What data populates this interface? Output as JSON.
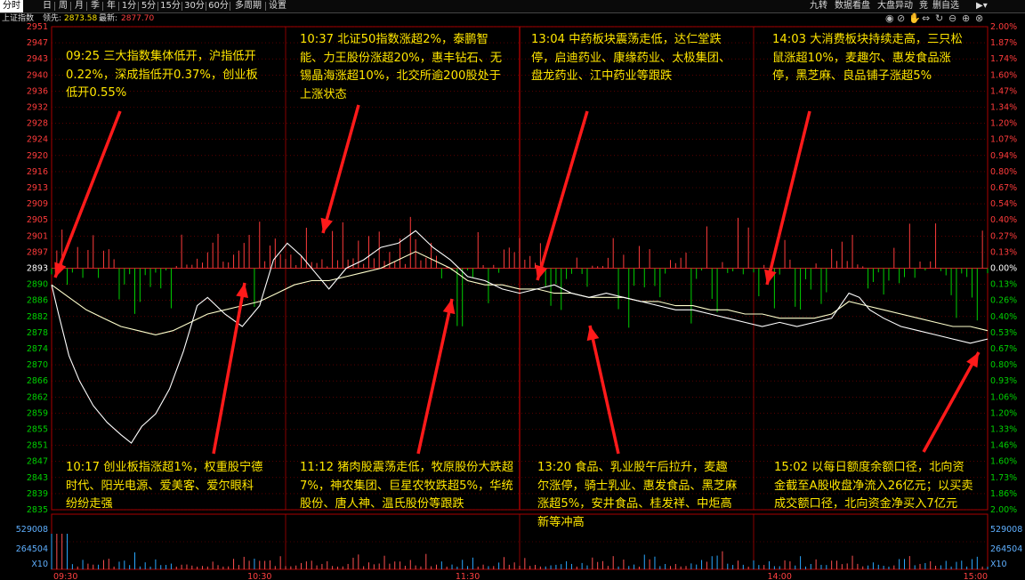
{
  "top_tabs": [
    {
      "label": "分时",
      "active": true
    },
    {
      "label": "日"
    },
    {
      "label": "周"
    },
    {
      "label": "月"
    },
    {
      "label": "季"
    },
    {
      "label": "年"
    },
    {
      "label": "1分"
    },
    {
      "label": "5分"
    },
    {
      "label": "15分"
    },
    {
      "label": "30分"
    },
    {
      "label": "60分"
    },
    {
      "label": "多周期"
    },
    {
      "label": "设置"
    }
  ],
  "right_tabs": [
    "九转",
    "数据看盘",
    "大盘异动",
    "竞",
    "删自选"
  ],
  "info": {
    "name": "上证指数",
    "lead_label": "领先:",
    "lead_value": "2873.58",
    "latest_label": "最新:",
    "latest_value": "2877.70"
  },
  "icons": [
    "eye-icon",
    "eye-off-icon",
    "hand-icon",
    "arrows-icon",
    "refresh-icon",
    "zoom-out-icon",
    "add-icon",
    "close-icon"
  ],
  "colors": {
    "up": "#ff3b3b",
    "down": "#00d000",
    "line_price": "#ffffff",
    "line_avg": "#ffffcc",
    "annotation": "#ffe600",
    "arrow": "#ff1a1a",
    "grid": "#8b0000"
  },
  "chart_data": {
    "type": "line",
    "prev_close": 2893,
    "y_ticks": [
      "2951",
      "2947",
      "2943",
      "2940",
      "2936",
      "2932",
      "2928",
      "2924",
      "2920",
      "2916",
      "2913",
      "2909",
      "2905",
      "2901",
      "2897",
      "2893",
      "2890",
      "2886",
      "2882",
      "2878",
      "2874",
      "2870",
      "2866",
      "2862",
      "2859",
      "2855",
      "2851",
      "2847",
      "2843",
      "2839",
      "2835"
    ],
    "pct_ticks": [
      "2.00%",
      "1.87%",
      "1.74%",
      "1.60%",
      "1.47%",
      "1.34%",
      "1.20%",
      "1.07%",
      "0.94%",
      "0.80%",
      "0.67%",
      "0.54%",
      "0.40%",
      "0.27%",
      "0.13%",
      "0.00%",
      "0.13%",
      "0.26%",
      "0.40%",
      "0.53%",
      "0.67%",
      "0.80%",
      "0.93%",
      "1.06%",
      "1.20%",
      "1.33%",
      "1.46%",
      "1.60%",
      "1.73%",
      "1.86%",
      "2.00%"
    ],
    "x_ticks": [
      "09:30",
      "10:30",
      "11:30",
      "14:00",
      "15:00"
    ],
    "volume_ticks": [
      "529008",
      "264504",
      "X10"
    ],
    "price": [
      [
        0,
        2889
      ],
      [
        2,
        2882
      ],
      [
        5,
        2872
      ],
      [
        8,
        2866
      ],
      [
        12,
        2860
      ],
      [
        16,
        2856
      ],
      [
        20,
        2853
      ],
      [
        23,
        2851
      ],
      [
        26,
        2855
      ],
      [
        30,
        2858
      ],
      [
        34,
        2864
      ],
      [
        38,
        2873
      ],
      [
        42,
        2884
      ],
      [
        45,
        2886
      ],
      [
        50,
        2882
      ],
      [
        55,
        2879
      ],
      [
        60,
        2884
      ],
      [
        64,
        2895
      ],
      [
        68,
        2899
      ],
      [
        72,
        2896
      ],
      [
        76,
        2892
      ],
      [
        80,
        2888
      ],
      [
        85,
        2893
      ],
      [
        90,
        2895
      ],
      [
        95,
        2898
      ],
      [
        100,
        2899
      ],
      [
        105,
        2902
      ],
      [
        110,
        2898
      ],
      [
        115,
        2895
      ],
      [
        120,
        2891
      ],
      [
        125,
        2890
      ],
      [
        130,
        2888
      ],
      [
        135,
        2887
      ],
      [
        140,
        2888
      ],
      [
        145,
        2889
      ],
      [
        150,
        2887
      ],
      [
        155,
        2886
      ],
      [
        160,
        2887
      ],
      [
        165,
        2886
      ],
      [
        170,
        2885
      ],
      [
        175,
        2884
      ],
      [
        180,
        2883
      ],
      [
        185,
        2883
      ],
      [
        190,
        2882
      ],
      [
        195,
        2881
      ],
      [
        200,
        2880
      ],
      [
        205,
        2879
      ],
      [
        210,
        2880
      ],
      [
        215,
        2879
      ],
      [
        220,
        2880
      ],
      [
        225,
        2881
      ],
      [
        230,
        2887
      ],
      [
        233,
        2886
      ],
      [
        236,
        2883
      ],
      [
        240,
        2881
      ],
      [
        245,
        2879
      ],
      [
        250,
        2878
      ],
      [
        255,
        2877
      ],
      [
        260,
        2876
      ],
      [
        265,
        2875
      ],
      [
        270,
        2876
      ]
    ],
    "avg": [
      [
        0,
        2889
      ],
      [
        5,
        2886
      ],
      [
        10,
        2883
      ],
      [
        15,
        2881
      ],
      [
        20,
        2879
      ],
      [
        25,
        2878
      ],
      [
        30,
        2877
      ],
      [
        35,
        2878
      ],
      [
        40,
        2880
      ],
      [
        45,
        2882
      ],
      [
        50,
        2883
      ],
      [
        55,
        2884
      ],
      [
        60,
        2885
      ],
      [
        65,
        2887
      ],
      [
        70,
        2889
      ],
      [
        75,
        2890
      ],
      [
        80,
        2890
      ],
      [
        85,
        2891
      ],
      [
        90,
        2892
      ],
      [
        95,
        2893
      ],
      [
        100,
        2895
      ],
      [
        105,
        2897
      ],
      [
        110,
        2895
      ],
      [
        115,
        2893
      ],
      [
        120,
        2890
      ],
      [
        125,
        2889
      ],
      [
        130,
        2889
      ],
      [
        135,
        2888
      ],
      [
        140,
        2888
      ],
      [
        145,
        2887
      ],
      [
        150,
        2887
      ],
      [
        155,
        2886
      ],
      [
        160,
        2886
      ],
      [
        165,
        2886
      ],
      [
        170,
        2885
      ],
      [
        175,
        2885
      ],
      [
        180,
        2884
      ],
      [
        185,
        2884
      ],
      [
        190,
        2883
      ],
      [
        195,
        2883
      ],
      [
        200,
        2882
      ],
      [
        205,
        2882
      ],
      [
        210,
        2881
      ],
      [
        215,
        2881
      ],
      [
        220,
        2881
      ],
      [
        225,
        2882
      ],
      [
        230,
        2885
      ],
      [
        235,
        2884
      ],
      [
        240,
        2883
      ],
      [
        245,
        2882
      ],
      [
        250,
        2881
      ],
      [
        255,
        2880
      ],
      [
        260,
        2879
      ],
      [
        265,
        2879
      ],
      [
        270,
        2878
      ]
    ]
  },
  "annotations": [
    {
      "id": "a1",
      "text": "09:25 三大指数集体低开，沪指低开0.22%，深成指低开0.37%，创业板低开0.55%"
    },
    {
      "id": "a2",
      "text": "10:37 北证50指数涨超2%，泰鹏智能、力王股份涨超20%，惠丰钻石、无锡晶海涨超10%，北交所逾200股处于上涨状态"
    },
    {
      "id": "a3",
      "text": "13:04 中药板块震荡走低，达仁堂跌停，启迪药业、康缘药业、太极集团、盘龙药业、江中药业等跟跌"
    },
    {
      "id": "a4",
      "text": "14:03 大消费板块持续走高，三只松鼠涨超10%，麦趣尔、惠发食品涨停，黑芝麻、良品铺子涨超5%"
    },
    {
      "id": "a5",
      "text": "10:17 创业板指涨超1%，权重股宁德时代、阳光电源、爱美客、爱尔眼科纷纷走强"
    },
    {
      "id": "a6",
      "text": "11:12 猪肉股震荡走低，牧原股份大跌超7%，神农集团、巨星农牧跌超5%，华统股份、唐人神、温氏股份等跟跌"
    },
    {
      "id": "a7",
      "text": "13:20 食品、乳业股午后拉升，麦趣尔涨停，骑士乳业、惠发食品、黑芝麻涨超5%，安井食品、桂发祥、中炬高新等冲高"
    },
    {
      "id": "a8",
      "text": "15:02 以每日额度余额口径，北向资金截至A股收盘净流入26亿元；以买卖成交额口径，北向资金净买入7亿元"
    }
  ]
}
